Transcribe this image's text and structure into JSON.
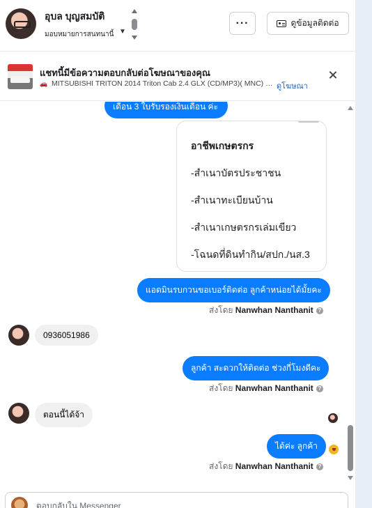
{
  "header": {
    "contact_name": "อุบล บุญสมบัติ",
    "assign_label": "มอบหมายการสนทนานี้",
    "more_label": "···",
    "contact_info_label": "ดูข้อมูลติดต่อ"
  },
  "ad": {
    "title": "แชทนี้มีข้อความตอบกลับต่อโฆษณาของคุณ",
    "car_icon": "🚗",
    "subtitle": "MITSUBISHI TRITON 2014 Triton Cab 2.4 GLX (CD/MP3)( MNC) (M...",
    "view_ad_label": "ดูโฆษณา"
  },
  "messages": {
    "top_out": "เดือน  3  ใบรับรองเงินเดือน ค่ะ",
    "doc_card": {
      "heading": "อาชีพเกษตรกร",
      "lines": [
        "-สำเนาบัตรประชาชน",
        "-สำเนาทะเบียนบ้าน",
        "-สำเนาเกษตรกรเล่มเขียว",
        "-โฉนดที่ดินทำกิน/สปก./นส.3"
      ]
    },
    "out_1": "แอดมินรบกวนขอเบอร์ติดต่อ ลูกค้าหน่อยได้มั้ยคะ",
    "in_1": "0936051986",
    "out_2": "ลูกค้า สะดวกให้ติดต่อ ช่วงกี่โมงดีคะ",
    "in_2": "ตอนนี้ได้จ้า",
    "out_3": "ได้ค่ะ  ลูกค้า"
  },
  "sent_by": {
    "prefix": "ส่งโดย",
    "name": "Nanwhan Nanthanit",
    "info_glyph": "?"
  },
  "composer": {
    "placeholder": "ตอบกลับใน Messenger"
  },
  "colors": {
    "outgoing_bubble": "#0a7cff",
    "incoming_bubble": "#f0f0f0",
    "link": "#1a66c5"
  }
}
